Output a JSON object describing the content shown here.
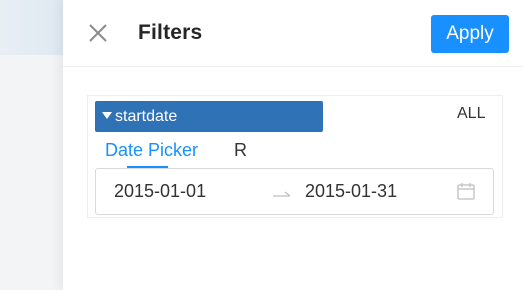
{
  "drawer": {
    "title": "Filters",
    "apply_label": "Apply",
    "close_icon": "close-icon",
    "accent_color": "#1890ff"
  },
  "filter": {
    "field_name": "startdate",
    "field_chip_color": "#2f73b6",
    "all_label": "ALL",
    "tabs": [
      {
        "label": "Date Picker",
        "active": true
      },
      {
        "label": "R",
        "active": false
      }
    ],
    "range": {
      "start": "2015-01-01",
      "end": "2015-01-31",
      "separator_icon": "arrow-right-icon",
      "calendar_icon": "calendar-icon"
    }
  }
}
